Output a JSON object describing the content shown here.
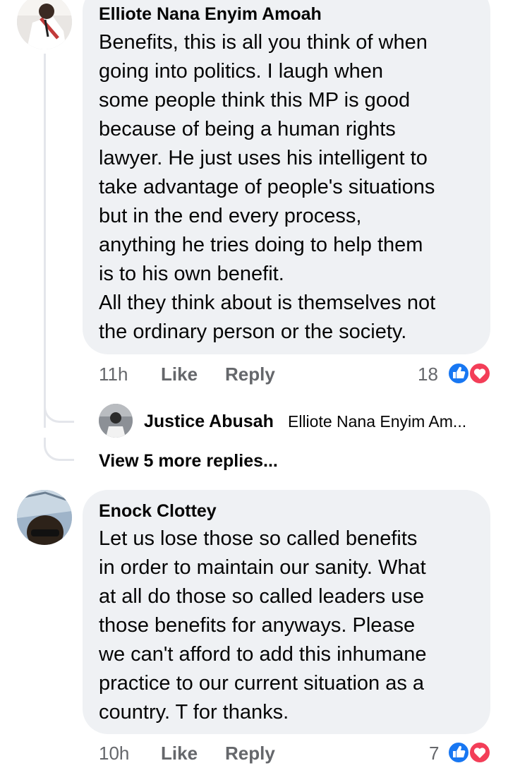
{
  "comments": [
    {
      "author": "Elliote Nana Enyim Amoah",
      "text": "Benefits, this is all you think of  when\ngoing into politics. I laugh when\nsome people think this MP is good\nbecause of being a human rights\nlawyer. He just uses his intelligent to\ntake advantage of people's situations\nbut in the end every process,\nanything he tries doing to help them\nis to his own benefit.\nAll they think about is themselves not\nthe ordinary person or the society.",
      "time": "11h",
      "like_label": "Like",
      "reply_label": "Reply",
      "reaction_count": "18"
    },
    {
      "author": "Enock Clottey",
      "text": "Let us lose those so called benefits\nin order to maintain our sanity. What\nat all do those so called leaders use\nthose benefits for anyways. Please\nwe can't afford to add this inhumane\npractice to our current situation as a\ncountry. T for thanks.",
      "time": "10h",
      "like_label": "Like",
      "reply_label": "Reply",
      "reaction_count": "7"
    }
  ],
  "reply_preview": {
    "author": "Justice Abusah",
    "snippet": "Elliote Nana Enyim Am..."
  },
  "view_more": "View 5 more replies...",
  "colors": {
    "bubble": "#eff1f4",
    "meta_text": "#65676b",
    "like_blue": "#1877f2",
    "love_red": "#f33e58"
  },
  "icons": [
    "like-reaction-icon",
    "love-reaction-icon"
  ]
}
